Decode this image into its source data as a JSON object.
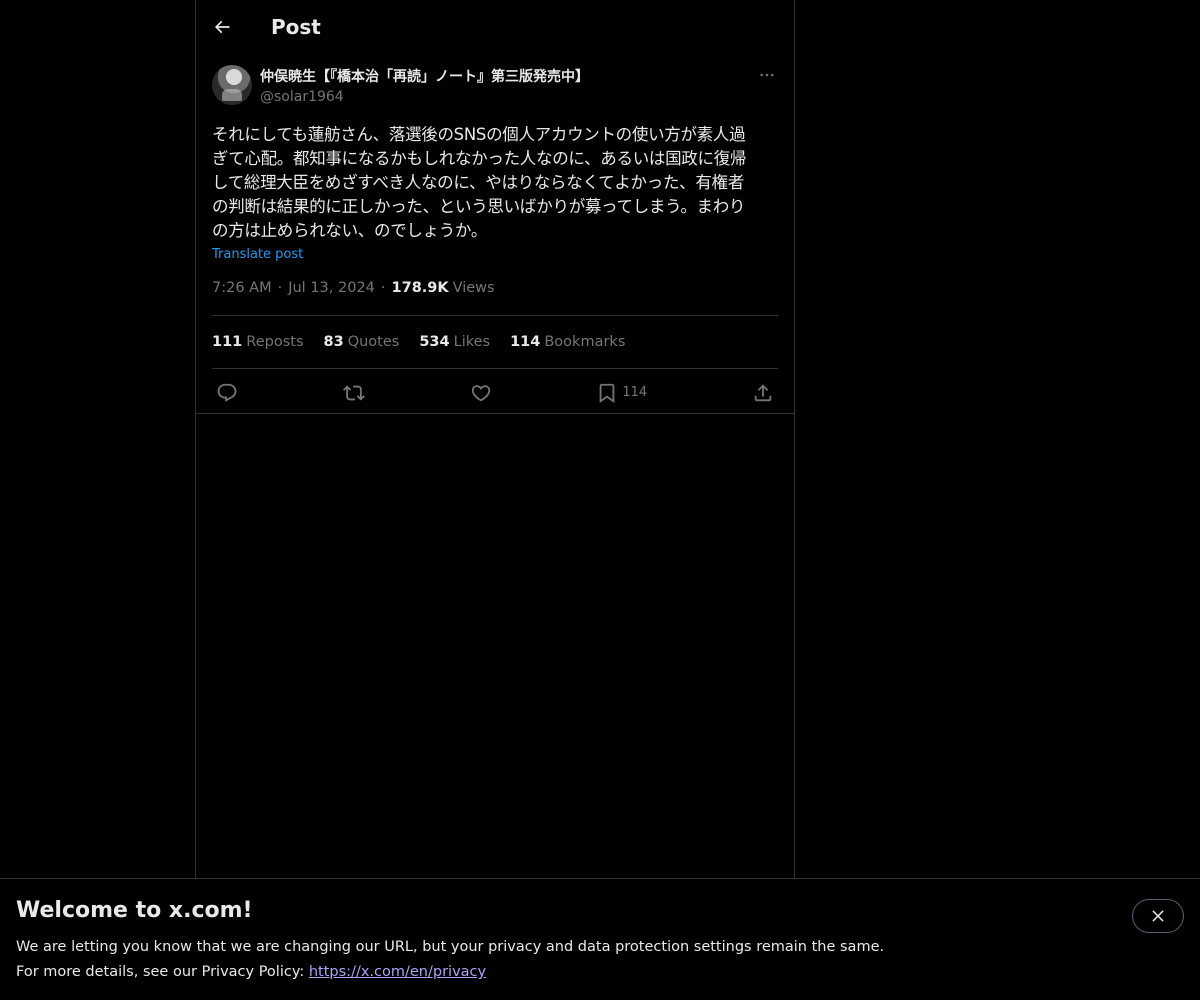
{
  "header": {
    "title": "Post"
  },
  "post": {
    "author": {
      "display_name": "仲俣暁生【『橋本治「再読」ノート』第三版発売中】",
      "handle": "@solar1964"
    },
    "text": "それにしても蓮舫さん、落選後のSNSの個人アカウントの使い方が素人過\nぎて心配。都知事になるかもしれなかった人なのに、あるいは国政に復帰\nして総理大臣をめざすべき人なのに、やはりならなくてよかった、有権者\nの判断は結果的に正しかった、という思いばかりが募ってしまう。まわり\nの方は止められない、のでしょうか。",
    "translate_label": "Translate post",
    "time": "7:26 AM",
    "date": "Jul 13, 2024",
    "separator": "·",
    "views_count": "178.9K",
    "views_label": "Views",
    "stats": {
      "reposts": {
        "count": "111",
        "label": "Reposts"
      },
      "quotes": {
        "count": "83",
        "label": "Quotes"
      },
      "likes": {
        "count": "534",
        "label": "Likes"
      },
      "bookmarks": {
        "count": "114",
        "label": "Bookmarks"
      }
    },
    "actions": {
      "reply_icon": "reply-icon",
      "repost_icon": "repost-icon",
      "like_icon": "heart-icon",
      "bookmark_icon": "bookmark-icon",
      "bookmark_count": "114",
      "share_icon": "share-icon"
    }
  },
  "banner": {
    "title": "Welcome to x.com!",
    "line1": "We are letting you know that we are changing our URL, but your privacy and data protection settings remain the same.",
    "line2_prefix": "For more details, see our Privacy Policy: ",
    "link_text": "https://x.com/en/privacy"
  },
  "colors": {
    "background": "#000000",
    "text_primary": "#e7e9ea",
    "text_secondary": "#71767b",
    "accent": "#1d9bf0",
    "border": "#2f3336",
    "link": "#a8a3f5"
  }
}
